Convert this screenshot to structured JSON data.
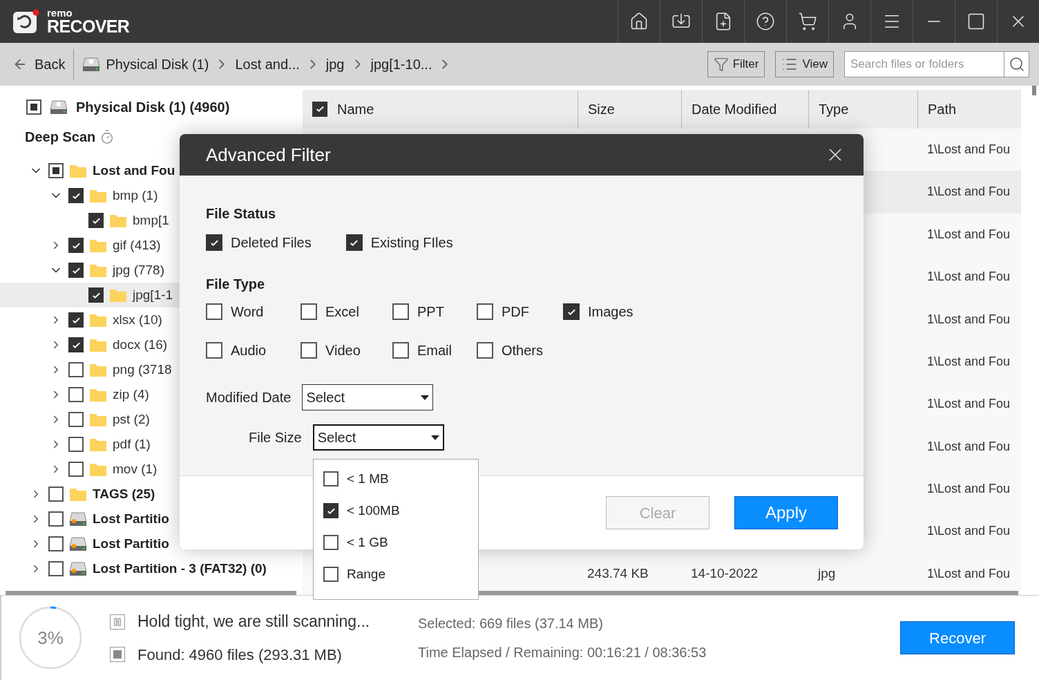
{
  "app": {
    "logo_small": "remo",
    "logo_big": "RECOVER"
  },
  "toolbar": {
    "back": "Back",
    "breadcrumbs": [
      {
        "label": "Physical Disk (1)",
        "kind": "drive"
      },
      {
        "label": "Lost and...",
        "kind": "text"
      },
      {
        "label": "jpg",
        "kind": "text"
      },
      {
        "label": "jpg[1-10...",
        "kind": "text"
      }
    ],
    "filter": "Filter",
    "view": "View",
    "search": {
      "placeholder": "Search files or folders"
    }
  },
  "tree": {
    "disk": {
      "label": "Physical Disk (1) (4960)",
      "partial": true
    },
    "scan_label": "Deep Scan",
    "items": [
      {
        "label": "Lost and Fou",
        "kind": "folder",
        "partial": true,
        "expanded": true,
        "selected": false,
        "children": [
          {
            "label": "bmp (1)",
            "kind": "folder",
            "checked": true,
            "expanded": true,
            "selected": false,
            "children": [
              {
                "label": "bmp[1",
                "kind": "folder",
                "checked": true,
                "selected": false
              }
            ]
          },
          {
            "label": "gif (413)",
            "kind": "folder",
            "checked": true,
            "expanded": false,
            "selected": false
          },
          {
            "label": "jpg (778)",
            "kind": "folder",
            "checked": true,
            "expanded": true,
            "selected": false,
            "children": [
              {
                "label": "jpg[1-1",
                "kind": "folder",
                "checked": true,
                "selected": true
              }
            ]
          },
          {
            "label": "xlsx (10)",
            "kind": "folder",
            "checked": true,
            "expanded": false,
            "selected": false
          },
          {
            "label": "docx (16)",
            "kind": "folder",
            "checked": true,
            "expanded": false,
            "selected": false
          },
          {
            "label": "png (3718",
            "kind": "folder",
            "checked": false,
            "expanded": false,
            "selected": false
          },
          {
            "label": "zip (4)",
            "kind": "folder",
            "checked": false,
            "expanded": false,
            "selected": false
          },
          {
            "label": "pst (2)",
            "kind": "folder",
            "checked": false,
            "expanded": false,
            "selected": false
          },
          {
            "label": "pdf (1)",
            "kind": "folder",
            "checked": false,
            "expanded": false,
            "selected": false
          },
          {
            "label": "mov (1)",
            "kind": "folder",
            "checked": false,
            "expanded": false,
            "selected": false
          }
        ]
      },
      {
        "label": "TAGS (25)",
        "kind": "folder",
        "checked": false,
        "expanded": false,
        "selected": false
      },
      {
        "label": "Lost Partitio",
        "kind": "drive",
        "checked": false,
        "expanded": false,
        "selected": false
      },
      {
        "label": "Lost Partitio",
        "kind": "drive",
        "checked": false,
        "expanded": false,
        "selected": false
      },
      {
        "label": "Lost Partition - 3 (FAT32) (0)",
        "kind": "drive",
        "checked": false,
        "expanded": false,
        "selected": false
      }
    ]
  },
  "table": {
    "all_checked": true,
    "columns": [
      "Name",
      "Size",
      "Date Modified",
      "Type",
      "Path"
    ],
    "rows": [
      {
        "path": "1\\Lost and Fou",
        "selected": false
      },
      {
        "path": "1\\Lost and Fou",
        "selected": true
      },
      {
        "path": "1\\Lost and Fou",
        "selected": false
      },
      {
        "path": "1\\Lost and Fou",
        "selected": false
      },
      {
        "path": "1\\Lost and Fou",
        "selected": false
      },
      {
        "path": "1\\Lost and Fou",
        "selected": false
      },
      {
        "path": "1\\Lost and Fou",
        "selected": false
      },
      {
        "path": "1\\Lost and Fou",
        "selected": false
      },
      {
        "path": "1\\Lost and Fou",
        "selected": false
      },
      {
        "path": "1\\Lost and Fou",
        "selected": false
      },
      {
        "size": "243.74 KB",
        "date": "14-10-2022",
        "type": "jpg",
        "path": "1\\Lost and Fou",
        "selected": false
      }
    ]
  },
  "dialog": {
    "title": "Advanced Filter",
    "status_heading": "File Status",
    "status": [
      {
        "label": "Deleted Files",
        "checked": true
      },
      {
        "label": "Existing FIles",
        "checked": true
      }
    ],
    "type_heading": "File Type",
    "types": [
      [
        {
          "label": "Word",
          "checked": false
        },
        {
          "label": "Excel",
          "checked": false
        },
        {
          "label": "PPT",
          "checked": false
        },
        {
          "label": "PDF",
          "checked": false
        },
        {
          "label": "Images",
          "checked": true
        }
      ],
      [
        {
          "label": "Audio",
          "checked": false
        },
        {
          "label": "Video",
          "checked": false
        },
        {
          "label": "Email",
          "checked": false
        },
        {
          "label": "Others",
          "checked": false
        }
      ]
    ],
    "modified_label": "Modified Date",
    "modified_value": "Select",
    "size_label": "File Size",
    "size_value": "Select",
    "size_open": true,
    "size_options": [
      {
        "label": "< 1 MB",
        "checked": false
      },
      {
        "label": "< 100MB",
        "checked": true
      },
      {
        "label": "< 1 GB",
        "checked": false
      },
      {
        "label": "Range",
        "checked": false
      }
    ],
    "clear": {
      "label": "Clear",
      "disabled": true
    },
    "apply": "Apply"
  },
  "status": {
    "percent": "3%",
    "level": 0.03,
    "message": "Hold tight, we are still scanning...",
    "found": "Found: 4960 files (293.31 MB)",
    "selected": "Selected: 669 files (37.14 MB)",
    "time": "Time Elapsed / Remaining: 00:16:21 / 08:36:53",
    "recover": "Recover"
  }
}
